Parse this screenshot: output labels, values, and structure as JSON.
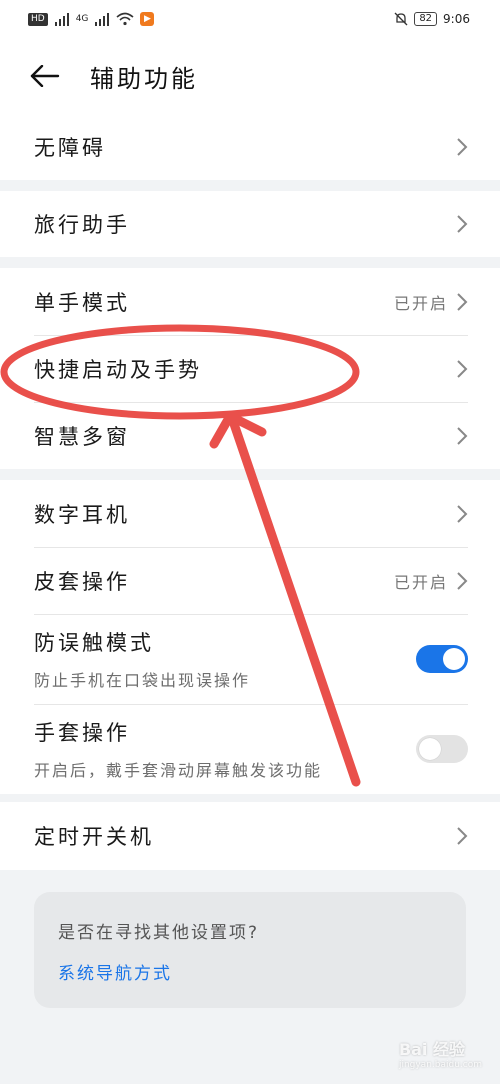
{
  "status_bar": {
    "hd1": "HD",
    "hd2": "HD",
    "network": "4G",
    "battery": "82",
    "time": "9:06"
  },
  "header": {
    "title": "辅助功能"
  },
  "groups": {
    "g1": {
      "accessibility": "无障碍"
    },
    "g2": {
      "travel": "旅行助手"
    },
    "g3": {
      "one_hand": "单手模式",
      "one_hand_status": "已开启",
      "shortcut": "快捷启动及手势",
      "multi_window": "智慧多窗"
    },
    "g4": {
      "digital_earphone": "数字耳机",
      "cover": "皮套操作",
      "cover_status": "已开启",
      "anti_touch": "防误触模式",
      "anti_touch_sub": "防止手机在口袋出现误操作",
      "anti_touch_on": true,
      "glove": "手套操作",
      "glove_sub": "开启后，戴手套滑动屏幕触发该功能",
      "glove_on": false
    },
    "g5": {
      "scheduled_power": "定时开关机"
    }
  },
  "hint": {
    "question": "是否在寻找其他设置项?",
    "link": "系统导航方式"
  },
  "annotation": {
    "color": "#e8423c"
  },
  "watermark": {
    "brand": "Bai 经验",
    "domain": "jingyan.baidu.com"
  }
}
